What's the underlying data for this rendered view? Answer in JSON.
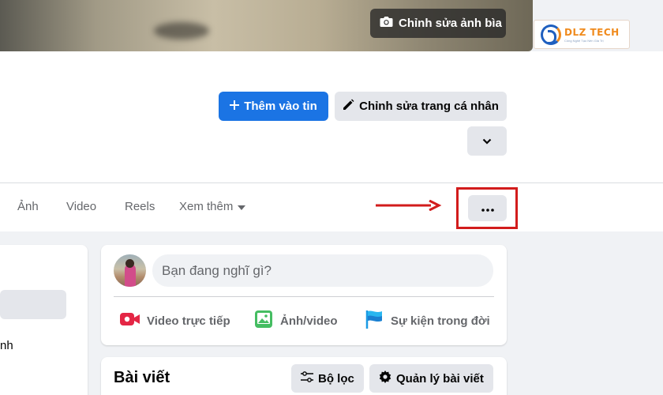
{
  "cover": {
    "edit_label": "Chỉnh sửa ảnh bìa"
  },
  "logo": {
    "name": "DLZ TECH",
    "tagline": "Công Nghệ Tạo Nên Giá Trị"
  },
  "profile_actions": {
    "add_story_label": "Thêm vào tin",
    "edit_profile_label": "Chỉnh sửa trang cá nhân"
  },
  "tabs": [
    {
      "label": "Ảnh"
    },
    {
      "label": "Video"
    },
    {
      "label": "Reels"
    },
    {
      "label": "Xem thêm"
    }
  ],
  "left_card": {
    "fragment": "nh"
  },
  "composer": {
    "placeholder": "Bạn đang nghĩ gì?",
    "actions": [
      {
        "label": "Video trực tiếp",
        "icon": "live-video-icon",
        "color": "#e42645"
      },
      {
        "label": "Ảnh/video",
        "icon": "photo-icon",
        "color": "#45bd62"
      },
      {
        "label": "Sự kiện trong đời",
        "icon": "flag-icon",
        "color": "#1b9ae4"
      }
    ]
  },
  "posts": {
    "title": "Bài viết",
    "filter_label": "Bộ lọc",
    "manage_label": "Quản lý bài viết"
  },
  "colors": {
    "primary": "#1b74e4",
    "highlight": "#d21c1c"
  }
}
